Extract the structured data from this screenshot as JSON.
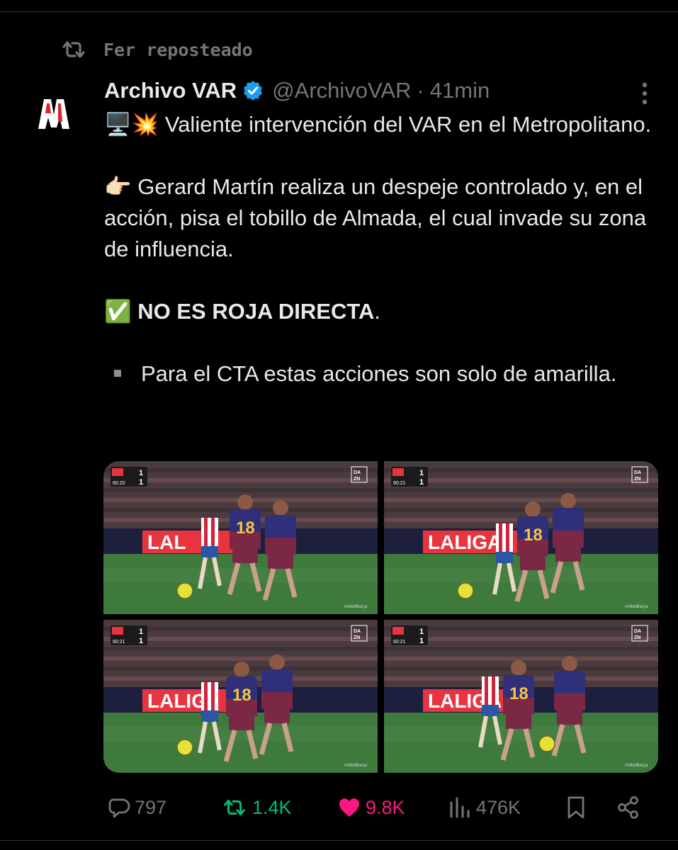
{
  "repost": {
    "label": "Fer reposteado",
    "icon": "repost-icon"
  },
  "author": {
    "name": "Archivo VAR",
    "verified": true,
    "handle": "@ArchivoVAR",
    "separator": "·",
    "time": "41min",
    "avatar_text": "AV",
    "avatar_color": "#d9252b"
  },
  "tweet": {
    "line1_emoji": "🖥️💥",
    "line1": " Valiente intervención del VAR en el Metropolitano.",
    "line2_emoji": "👉🏻",
    "line2": " Gerard Martín realiza un despeje controlado y, en el acción, pisa el tobillo de Almada, el cual invade su zona de influencia.",
    "line3_emoji": "✅",
    "line3_bold": "NO ES ROJA DIRECTA",
    "line3_tail": ".",
    "line4": "Para el CTA estas acciones son solo de amarilla."
  },
  "media": {
    "frames": [
      {
        "score_home": "1",
        "score_away": "1",
        "clock": "60:20",
        "watermark": "#AtletiBarça",
        "board": "LAL",
        "broadcaster": "DAZN",
        "jersey": "18"
      },
      {
        "score_home": "1",
        "score_away": "1",
        "clock": "60:21",
        "watermark": "#AtletiBarça",
        "board": "LALIGA",
        "broadcaster": "DAZN",
        "jersey": "18"
      },
      {
        "score_home": "1",
        "score_away": "1",
        "clock": "60:21",
        "watermark": "#AtletiBarça",
        "board": "LALIG",
        "broadcaster": "DAZN",
        "jersey": "18"
      },
      {
        "score_home": "1",
        "score_away": "1",
        "clock": "60:21",
        "watermark": "#AtletiBarça",
        "board": "LALIGA",
        "broadcaster": "DAZN",
        "jersey": "18"
      }
    ]
  },
  "actions": {
    "replies": "797",
    "reposts": "1.4K",
    "likes": "9.8K",
    "views": "476K",
    "colors": {
      "muted": "#71767b",
      "repost": "#00ba7c",
      "like": "#f91880"
    }
  }
}
